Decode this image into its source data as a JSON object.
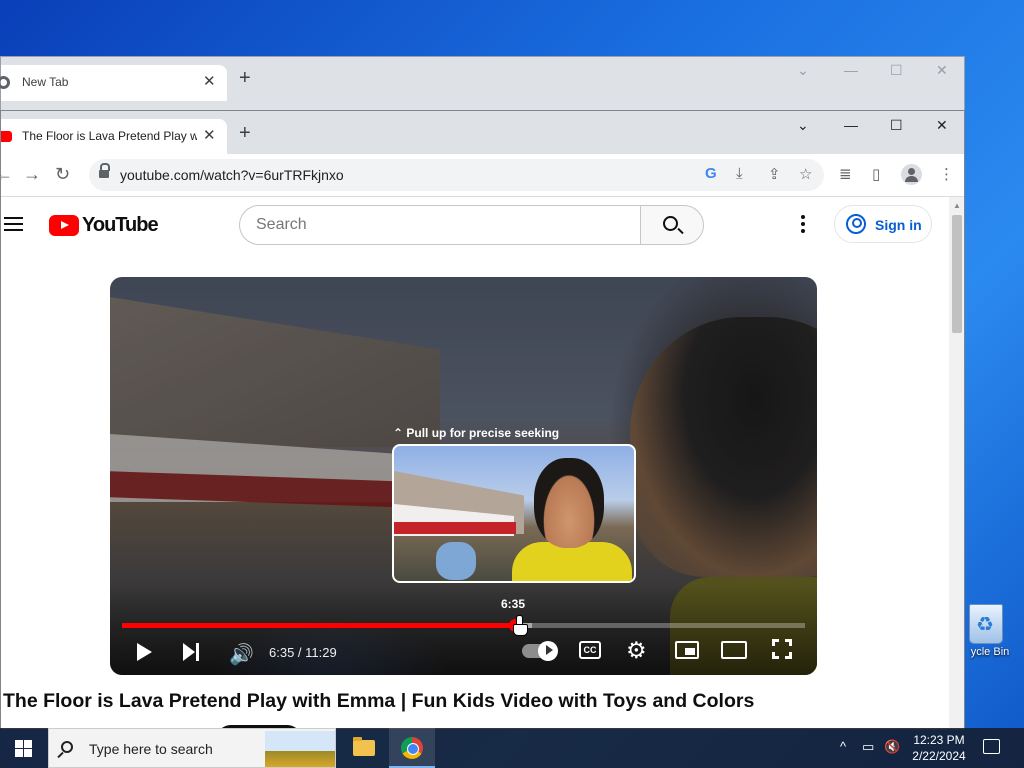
{
  "desktop": {
    "recycle_bin_label": "ycle Bin"
  },
  "back_window": {
    "tab_title": "New Tab",
    "icons": {
      "close": "✕",
      "new_tab": "+",
      "chevron": "⌄",
      "minimize": "—",
      "maximize": "☐",
      "window_close": "✕"
    }
  },
  "browser": {
    "tab_title": "The Floor is Lava Pretend Play with Emma | Fun Kids Video with Toys and Colors",
    "url": "youtube.com/watch?v=6urTRFkjnxo",
    "icons": {
      "close": "✕",
      "new_tab": "+",
      "chevron": "⌄",
      "minimize": "—",
      "maximize": "☐",
      "window_close": "✕",
      "back": "←",
      "forward": "→",
      "reload": "↻",
      "google": "G",
      "install": "⤓",
      "share": "⇪",
      "bookmark": "☆",
      "media": "≣",
      "sidepanel": "▯",
      "menu": "⋮"
    }
  },
  "youtube": {
    "search_placeholder": "Search",
    "sign_in_label": "Sign in",
    "video_title": "The Floor is Lava Pretend Play with Emma | Fun Kids Video with Toys and Colors"
  },
  "player": {
    "seek_hint": "⌃ Pull up for precise seeking",
    "hover_time": "6:35",
    "time_display": "6:35 / 11:29",
    "cc_label": "CC",
    "volume_icon": "🔊",
    "gear_icon": "⚙",
    "progress_fraction": 0.575,
    "buffered_fraction": 0.6
  },
  "taskbar": {
    "search_placeholder": "Type here to search",
    "time": "12:23 PM",
    "date": "2/22/2024",
    "icons": {
      "chevron_up": "^",
      "network": "▭",
      "volume": "🔇"
    }
  }
}
